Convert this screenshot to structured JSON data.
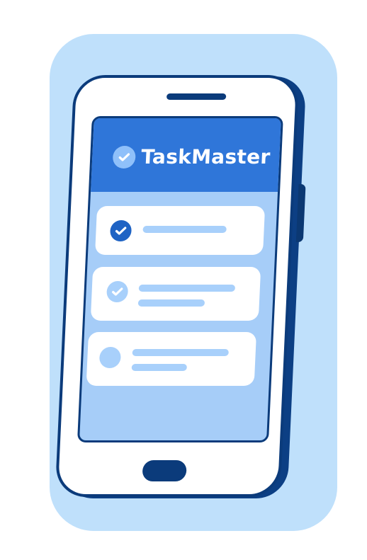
{
  "app": {
    "title": "TaskMaster"
  },
  "icons": {
    "logo": "checkmark-circle-icon",
    "task_done": "checkmark-circle-icon",
    "task_pending": "empty-circle-icon"
  },
  "tasks": [
    {
      "status": "completed",
      "icon": "checkmark-circle-icon"
    },
    {
      "status": "completed",
      "icon": "checkmark-circle-icon"
    },
    {
      "status": "pending",
      "icon": "empty-circle-icon"
    }
  ],
  "colors": {
    "background": "#bfe0fb",
    "header": "#2f76d9",
    "phone_outline": "#0b3b7b",
    "screen": "#a6cdf8",
    "placeholder_line": "#a8d0fb",
    "check_dark": "#1f63c4"
  }
}
